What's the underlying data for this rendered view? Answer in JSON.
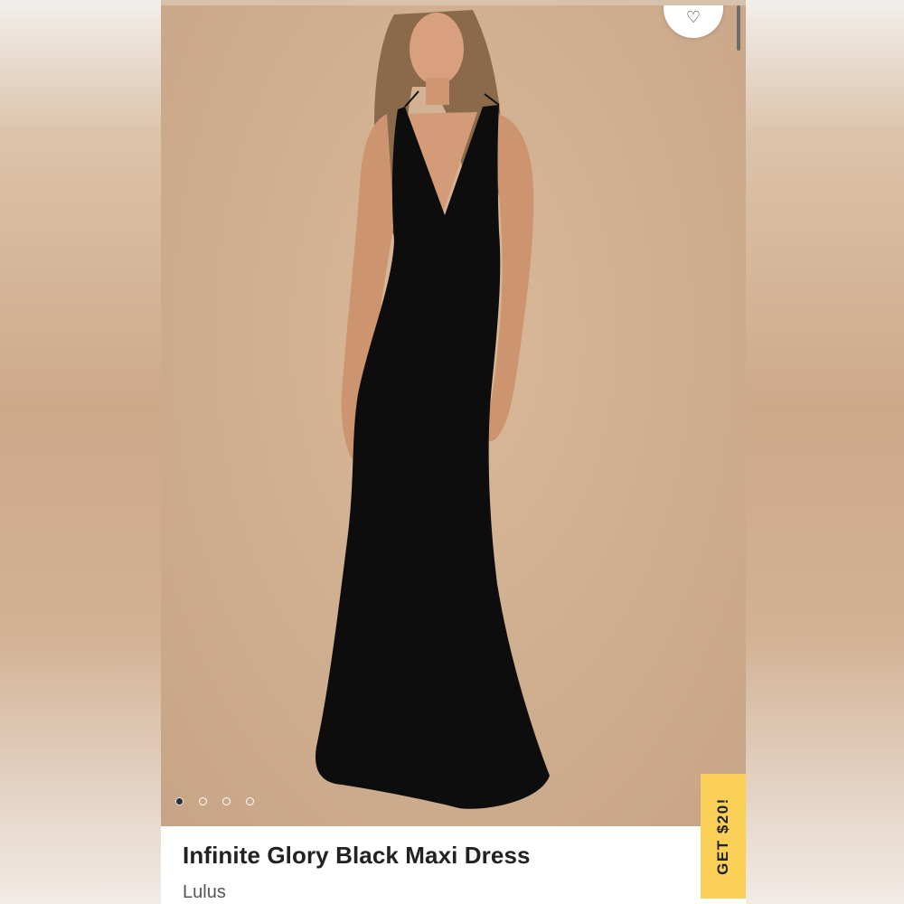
{
  "listing": {
    "title": "Infinite Glory Black Maxi Dress",
    "brand": "Lulus"
  },
  "carousel": {
    "image_count": 4,
    "active_index": 0
  },
  "promo": {
    "label": "GET $20!"
  },
  "icons": {
    "like": "heart-icon"
  },
  "colors": {
    "promo_tab": "#f9cf55",
    "dress": "#0d0d0d",
    "backdrop": "#cfae8f"
  }
}
